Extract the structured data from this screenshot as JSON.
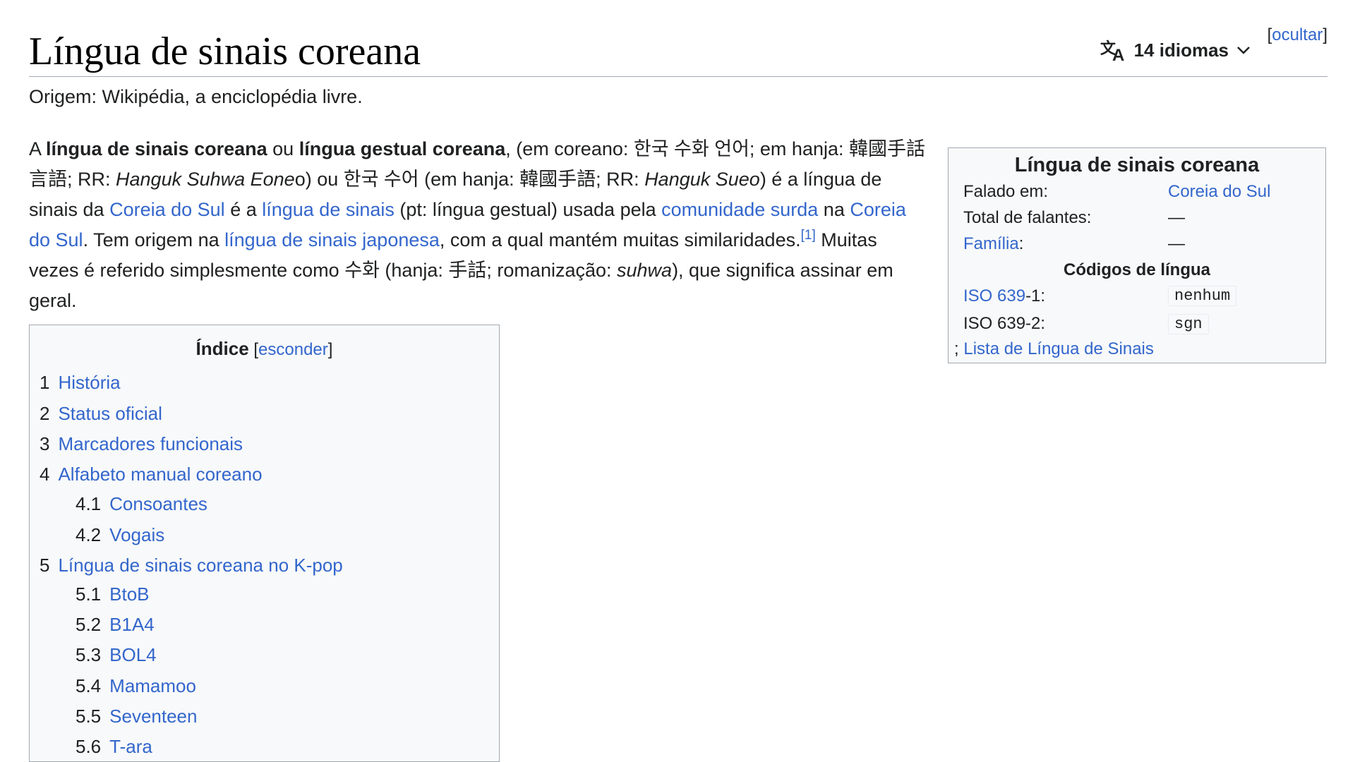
{
  "header": {
    "title": "Língua de sinais coreana",
    "languages_label": "14 idiomas",
    "hide_bracket_open": "[",
    "hide_label": "ocultar",
    "hide_bracket_close": "]"
  },
  "tagline": "Origem: Wikipédia, a enciclopédia livre.",
  "lead": {
    "t1": "A ",
    "b1": "língua de sinais coreana",
    "t2": " ou ",
    "b2": "língua gestual coreana",
    "t3": ", (em coreano: 한국 수화 언어; em hanja: 韓國手話言語; RR:  ",
    "i1": "Hanguk Suhwa Eone",
    "t4": "o) ou 한국 수어 (em hanja: 韓國手語; RR: ",
    "i2": "Hanguk Sueo",
    "t5": ") é a língua de sinais da ",
    "l1": "Coreia do Sul",
    "t6": " é a ",
    "l2": "língua de sinais",
    "t7": " (pt: língua gestual) usada pela ",
    "l3": "comunidade surda",
    "t8": " na ",
    "l4": "Coreia do Sul",
    "t9": ". Tem origem na ",
    "l5": "língua de sinais japonesa",
    "t10": ", com a qual mantém muitas similaridades.",
    "ref": "[1]",
    "t11": " Muitas vezes é referido simplesmente como 수화 (hanja: 手話; romanização: ",
    "i3": "suhwa",
    "t12": "), que significa assinar em geral."
  },
  "infobox": {
    "title": "Língua de sinais coreana",
    "spoken_in_label": "Falado em:",
    "spoken_in_value": "Coreia do Sul",
    "speakers_label": "Total de falantes:",
    "speakers_value": "—",
    "family_label": "Família",
    "family_colon": ":",
    "family_value": "—",
    "codes_heading": "Códigos de língua",
    "iso1_link": "ISO 639",
    "iso1_suffix": "-1:",
    "iso1_value": "nenhum",
    "iso2_label": "ISO 639-2:",
    "iso2_value": "sgn",
    "list_prefix": "; ",
    "list_link": "Lista de Língua de Sinais"
  },
  "toc": {
    "title": "Índice",
    "bracket_open": " [",
    "hide_label": "esconder",
    "bracket_close": "]",
    "items": [
      {
        "num": "1",
        "label": "História"
      },
      {
        "num": "2",
        "label": "Status oficial"
      },
      {
        "num": "3",
        "label": "Marcadores funcionais"
      },
      {
        "num": "4",
        "label": "Alfabeto manual coreano"
      },
      {
        "num": "4.1",
        "label": "Consoantes"
      },
      {
        "num": "4.2",
        "label": "Vogais"
      },
      {
        "num": "5",
        "label": "Língua de sinais coreana no K-pop"
      },
      {
        "num": "5.1",
        "label": "BtoB"
      },
      {
        "num": "5.2",
        "label": "B1A4"
      },
      {
        "num": "5.3",
        "label": "BOL4"
      },
      {
        "num": "5.4",
        "label": "Mamamoo"
      },
      {
        "num": "5.5",
        "label": "Seventeen"
      },
      {
        "num": "5.6",
        "label": "T-ara"
      }
    ]
  }
}
